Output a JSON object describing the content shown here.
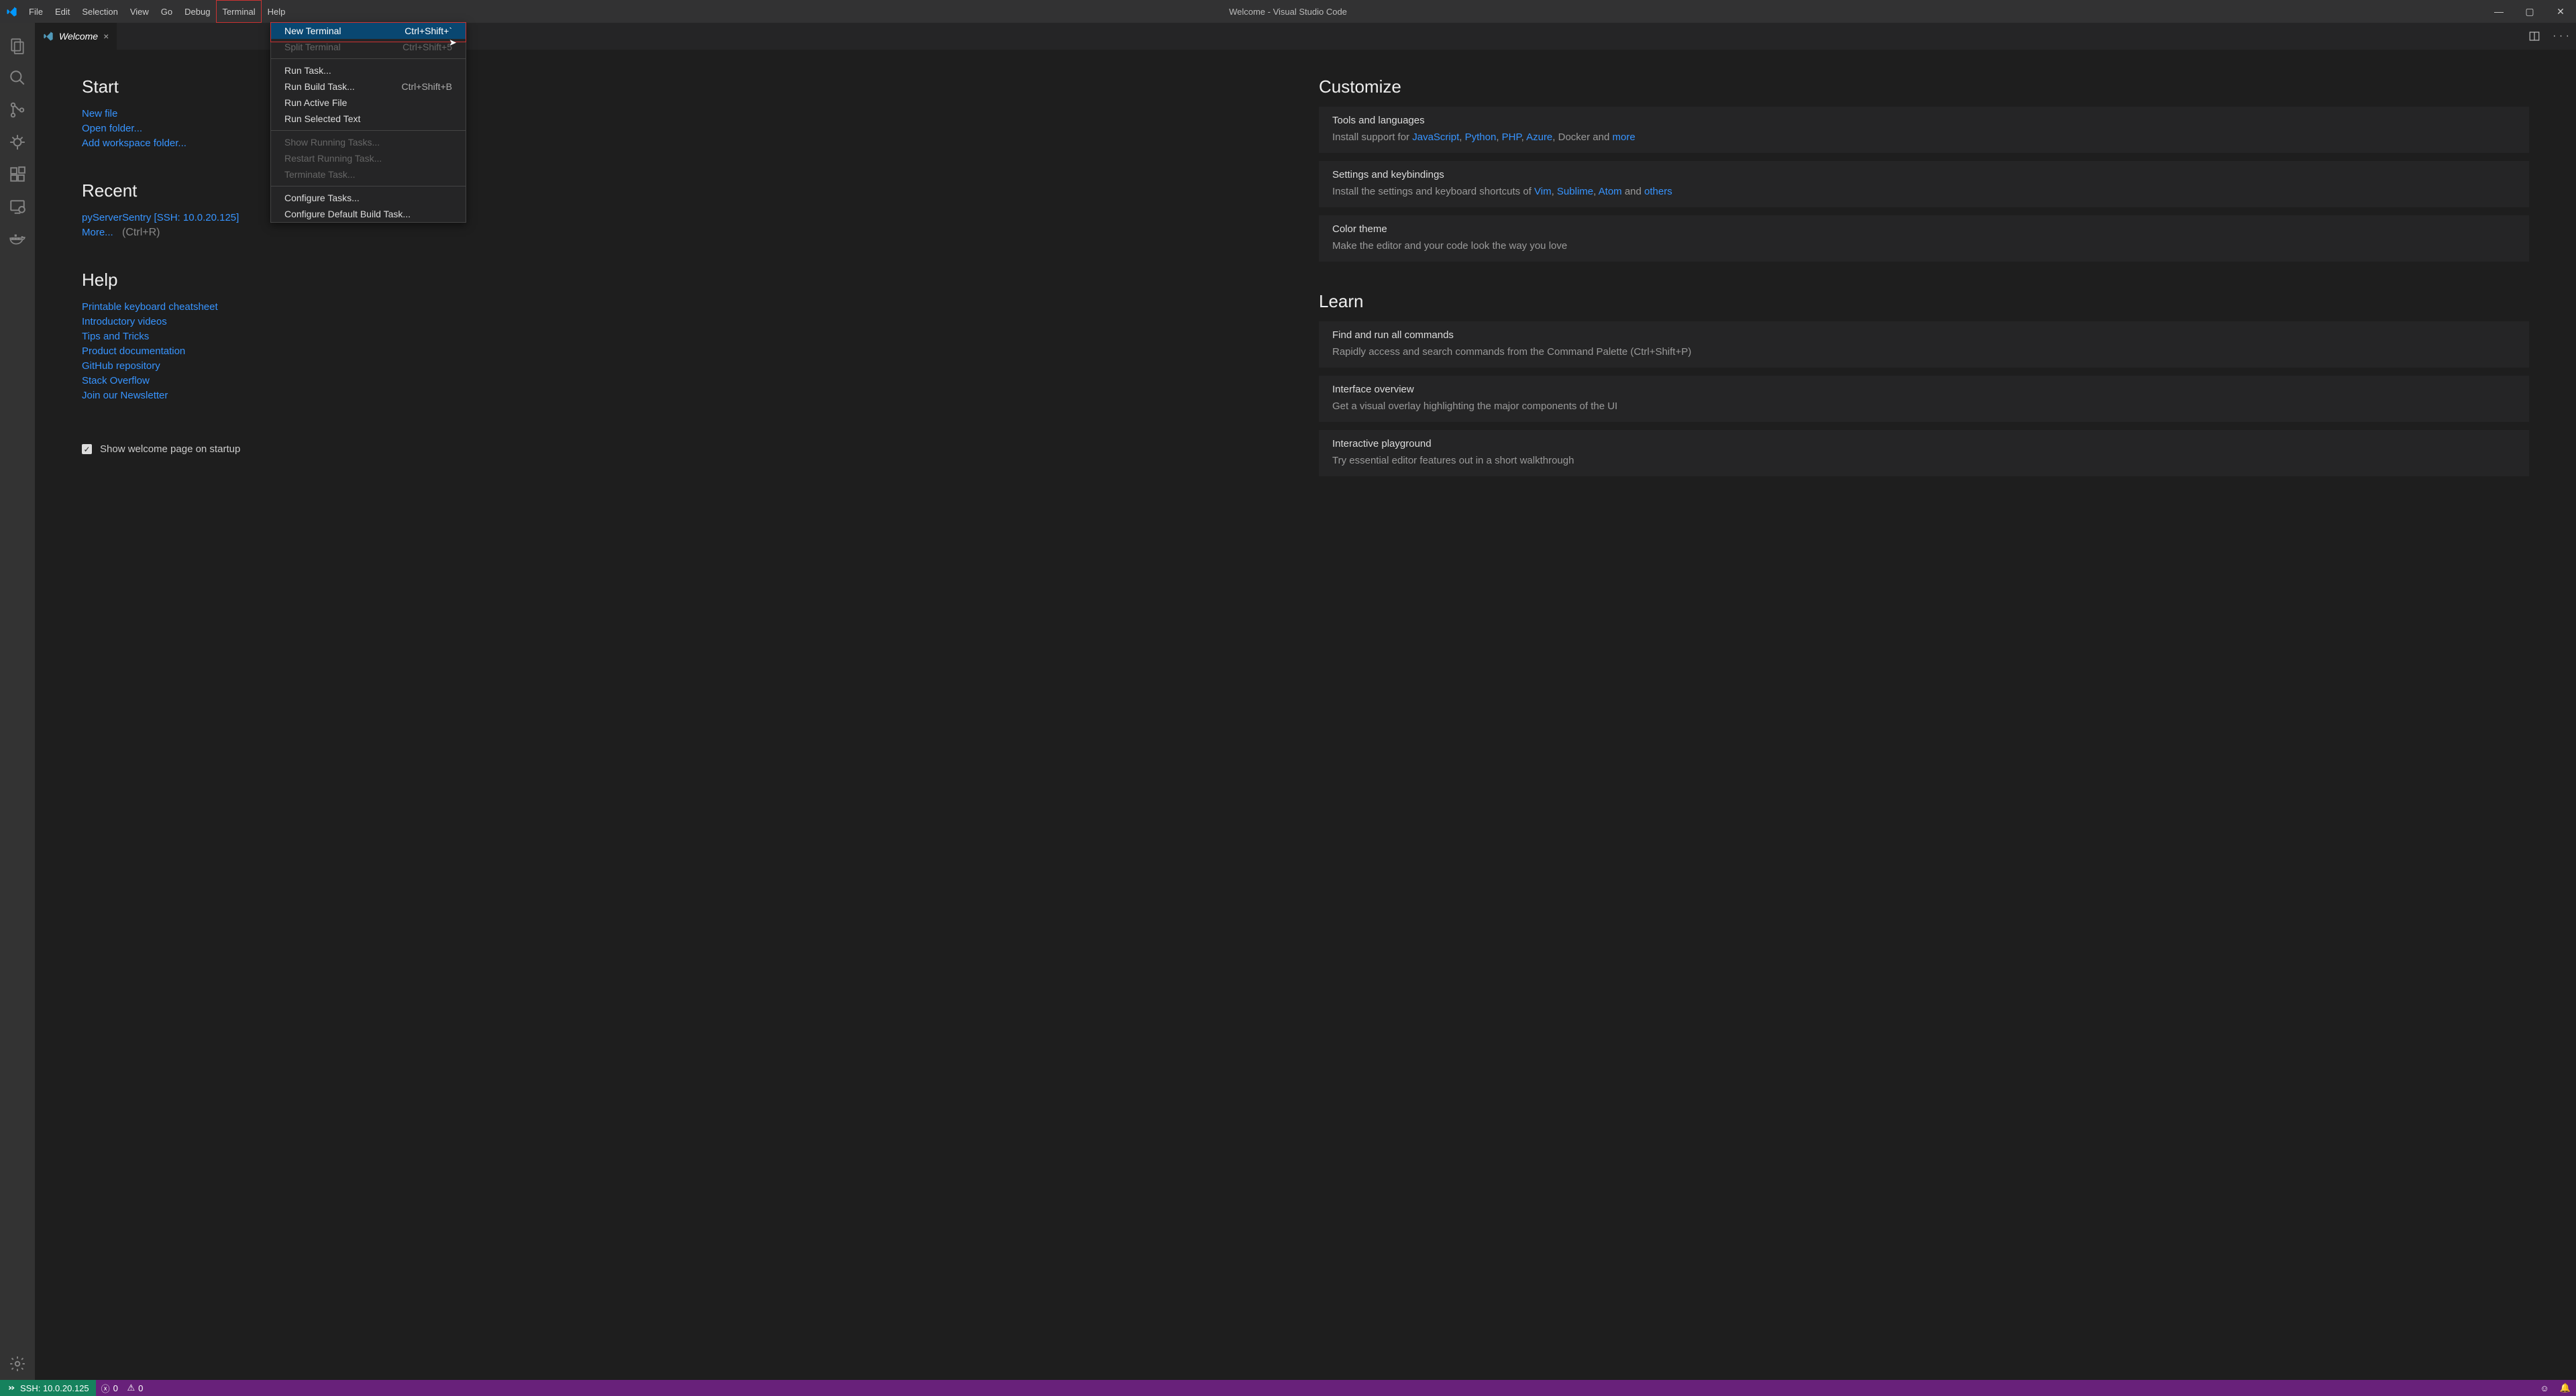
{
  "title": "Welcome - Visual Studio Code",
  "menubar": [
    "File",
    "Edit",
    "Selection",
    "View",
    "Go",
    "Debug",
    "Terminal",
    "Help"
  ],
  "activeMenuIndex": 6,
  "dropdown": {
    "groups": [
      [
        {
          "label": "New Terminal",
          "kb": "Ctrl+Shift+`",
          "selected": true
        },
        {
          "label": "Split Terminal",
          "kb": "Ctrl+Shift+5",
          "disabled": true
        }
      ],
      [
        {
          "label": "Run Task..."
        },
        {
          "label": "Run Build Task...",
          "kb": "Ctrl+Shift+B"
        },
        {
          "label": "Run Active File"
        },
        {
          "label": "Run Selected Text"
        }
      ],
      [
        {
          "label": "Show Running Tasks...",
          "disabled": true
        },
        {
          "label": "Restart Running Task...",
          "disabled": true
        },
        {
          "label": "Terminate Task...",
          "disabled": true
        }
      ],
      [
        {
          "label": "Configure Tasks..."
        },
        {
          "label": "Configure Default Build Task..."
        }
      ]
    ]
  },
  "tab": {
    "label": "Welcome"
  },
  "start": {
    "heading": "Start",
    "links": [
      "New file",
      "Open folder...",
      "Add workspace folder..."
    ]
  },
  "recent": {
    "heading": "Recent",
    "item": "pyServerSentry [SSH: 10.0.20.125]",
    "more": "More...",
    "moreKb": "(Ctrl+R)"
  },
  "help": {
    "heading": "Help",
    "links": [
      "Printable keyboard cheatsheet",
      "Introductory videos",
      "Tips and Tricks",
      "Product documentation",
      "GitHub repository",
      "Stack Overflow",
      "Join our Newsletter"
    ]
  },
  "showWelcome": "Show welcome page on startup",
  "customize": {
    "heading": "Customize",
    "cards": [
      {
        "title": "Tools and languages",
        "prefix": "Install support for ",
        "links": [
          "JavaScript",
          "Python",
          "PHP",
          "Azure"
        ],
        "mid": ", Docker and ",
        "suffixLink": "more"
      },
      {
        "title": "Settings and keybindings",
        "prefix": "Install the settings and keyboard shortcuts of ",
        "links": [
          "Vim",
          "Sublime",
          "Atom"
        ],
        "mid": " and ",
        "suffixLink": "others"
      },
      {
        "title": "Color theme",
        "desc": "Make the editor and your code look the way you love"
      }
    ]
  },
  "learn": {
    "heading": "Learn",
    "cards": [
      {
        "title": "Find and run all commands",
        "desc": "Rapidly access and search commands from the Command Palette (Ctrl+Shift+P)"
      },
      {
        "title": "Interface overview",
        "desc": "Get a visual overlay highlighting the major components of the UI"
      },
      {
        "title": "Interactive playground",
        "desc": "Try essential editor features out in a short walkthrough"
      }
    ]
  },
  "statusbar": {
    "remote": "SSH: 10.0.20.125",
    "errors": "0",
    "warnings": "0"
  }
}
